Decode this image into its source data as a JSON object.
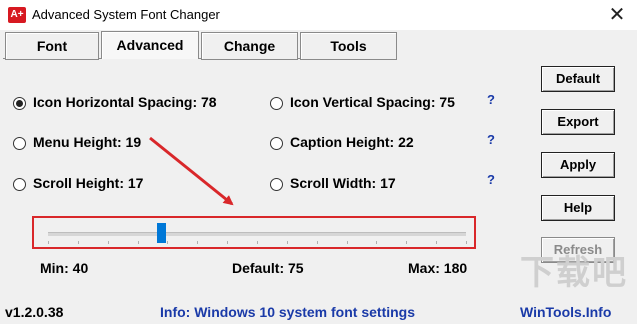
{
  "window": {
    "title": "Advanced System Font Changer",
    "app_icon_label": "A+"
  },
  "tabs": [
    {
      "label": "Font"
    },
    {
      "label": "Advanced"
    },
    {
      "label": "Change"
    },
    {
      "label": "Tools"
    }
  ],
  "options": {
    "icon_horizontal": {
      "label": "Icon Horizontal Spacing: 78",
      "selected": true
    },
    "icon_vertical": {
      "label": "Icon Vertical Spacing: 75",
      "help": "?"
    },
    "menu_height": {
      "label": "Menu Height: 19"
    },
    "caption_height": {
      "label": "Caption Height: 22",
      "help": "?"
    },
    "scroll_height": {
      "label": "Scroll Height: 17"
    },
    "scroll_width": {
      "label": "Scroll Width: 17",
      "help": "?"
    }
  },
  "buttons": {
    "default": "Default",
    "export": "Export",
    "apply": "Apply",
    "help": "Help",
    "refresh": "Refresh"
  },
  "slider": {
    "min_label": "Min: 40",
    "default_label": "Default: 75",
    "max_label": "Max: 180",
    "min": 40,
    "max": 180,
    "value": 78
  },
  "footer": {
    "version": "v1.2.0.38",
    "info": "Info: Windows 10 system font settings",
    "site": "WinTools.Info"
  },
  "colors": {
    "highlight_border": "#d9272a",
    "annotation_arrow": "#d9272a",
    "slider_thumb": "#0078d7",
    "info_text": "#1a3aa8"
  },
  "watermark": "下载吧"
}
